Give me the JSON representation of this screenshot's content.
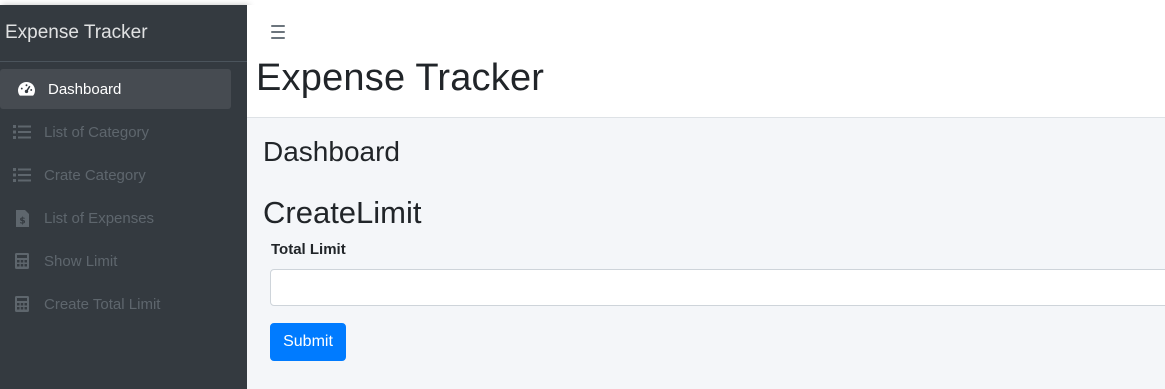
{
  "sidebar": {
    "brand": "Expense Tracker",
    "items": [
      {
        "label": "Dashboard",
        "icon": "speedometer-icon",
        "active": true
      },
      {
        "label": "List of Category",
        "icon": "list-icon",
        "active": false
      },
      {
        "label": "Crate Category",
        "icon": "list-icon",
        "active": false
      },
      {
        "label": "List of Expenses",
        "icon": "invoice-icon",
        "active": false
      },
      {
        "label": "Show Limit",
        "icon": "calculator-icon",
        "active": false
      },
      {
        "label": "Create Total Limit",
        "icon": "calculator-icon",
        "active": false
      }
    ]
  },
  "header": {
    "menu_icon": "hamburger-menu-icon",
    "title": "Expense Tracker"
  },
  "main": {
    "section_title": "Dashboard",
    "form_title": "CreateLimit",
    "field_label": "Total Limit",
    "field_value": "",
    "submit_label": "Submit"
  },
  "colors": {
    "sidebar_bg": "#343a40",
    "content_bg": "#f4f6f9",
    "primary": "#007bff"
  }
}
